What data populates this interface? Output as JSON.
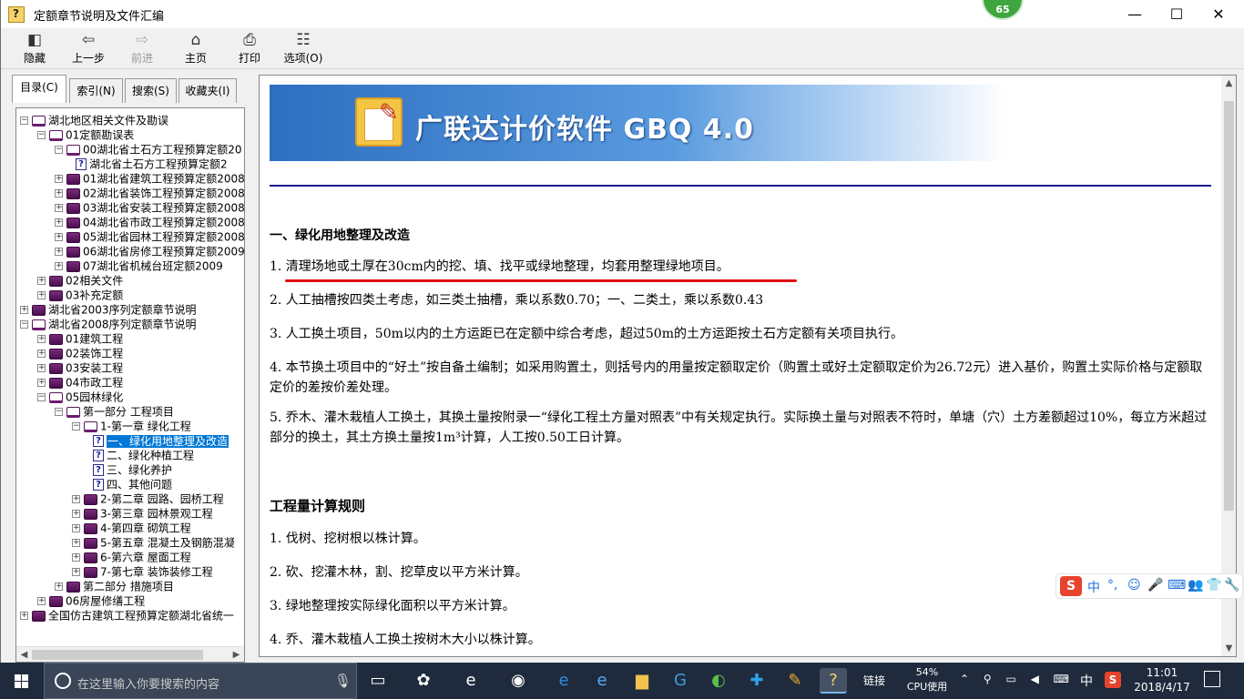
{
  "window": {
    "title": "定额章节说明及文件汇编",
    "badge": "65"
  },
  "toolbar": {
    "hide": "隐藏",
    "back": "上一步",
    "forward": "前进",
    "home": "主页",
    "print": "打印",
    "options": "选项(O)"
  },
  "tabs": [
    "目录(C)",
    "索引(N)",
    "搜索(S)",
    "收藏夹(I)"
  ],
  "tree": [
    {
      "label": "湖北地区相关文件及勘误",
      "level": 0,
      "exp": "-",
      "icon": "book-open"
    },
    {
      "label": "01定额勘误表",
      "level": 1,
      "exp": "-",
      "icon": "book-open"
    },
    {
      "label": "00湖北省土石方工程预算定额20",
      "level": 2,
      "exp": "-",
      "icon": "book-open"
    },
    {
      "label": "湖北省土石方工程预算定额2",
      "level": 3,
      "exp": "",
      "icon": "help-page"
    },
    {
      "label": "01湖北省建筑工程预算定额2008",
      "level": 2,
      "exp": "+",
      "icon": "book-closed"
    },
    {
      "label": "02湖北省装饰工程预算定额2008",
      "level": 2,
      "exp": "+",
      "icon": "book-closed"
    },
    {
      "label": "03湖北省安装工程预算定额2008",
      "level": 2,
      "exp": "+",
      "icon": "book-closed"
    },
    {
      "label": "04湖北省市政工程预算定额2008",
      "level": 2,
      "exp": "+",
      "icon": "book-closed"
    },
    {
      "label": "05湖北省园林工程预算定额2008",
      "level": 2,
      "exp": "+",
      "icon": "book-closed"
    },
    {
      "label": "06湖北省房修工程预算定额2009",
      "level": 2,
      "exp": "+",
      "icon": "book-closed"
    },
    {
      "label": "07湖北省机械台班定额2009",
      "level": 2,
      "exp": "+",
      "icon": "book-closed"
    },
    {
      "label": "02相关文件",
      "level": 1,
      "exp": "+",
      "icon": "book-closed"
    },
    {
      "label": "03补充定额",
      "level": 1,
      "exp": "+",
      "icon": "book-closed"
    },
    {
      "label": "湖北省2003序列定额章节说明",
      "level": 0,
      "exp": "+",
      "icon": "book-closed"
    },
    {
      "label": "湖北省2008序列定额章节说明",
      "level": 0,
      "exp": "-",
      "icon": "book-open"
    },
    {
      "label": "01建筑工程",
      "level": 1,
      "exp": "+",
      "icon": "book-closed"
    },
    {
      "label": "02装饰工程",
      "level": 1,
      "exp": "+",
      "icon": "book-closed"
    },
    {
      "label": "03安装工程",
      "level": 1,
      "exp": "+",
      "icon": "book-closed"
    },
    {
      "label": "04市政工程",
      "level": 1,
      "exp": "+",
      "icon": "book-closed"
    },
    {
      "label": "05园林绿化",
      "level": 1,
      "exp": "-",
      "icon": "book-open"
    },
    {
      "label": "第一部分 工程项目",
      "level": 2,
      "exp": "-",
      "icon": "book-open"
    },
    {
      "label": "1-第一章 绿化工程",
      "level": 3,
      "exp": "-",
      "icon": "book-open"
    },
    {
      "label": "一、绿化用地整理及改造",
      "level": 4,
      "exp": "",
      "icon": "help-page",
      "selected": true
    },
    {
      "label": "二、绿化种植工程",
      "level": 4,
      "exp": "",
      "icon": "help-page"
    },
    {
      "label": "三、绿化养护",
      "level": 4,
      "exp": "",
      "icon": "help-page"
    },
    {
      "label": "四、其他问题",
      "level": 4,
      "exp": "",
      "icon": "help-page"
    },
    {
      "label": "2-第二章 园路、园桥工程",
      "level": 3,
      "exp": "+",
      "icon": "book-closed"
    },
    {
      "label": "3-第三章 园林景观工程",
      "level": 3,
      "exp": "+",
      "icon": "book-closed"
    },
    {
      "label": "4-第四章 砌筑工程",
      "level": 3,
      "exp": "+",
      "icon": "book-closed"
    },
    {
      "label": "5-第五章 混凝土及钢筋混凝",
      "level": 3,
      "exp": "+",
      "icon": "book-closed"
    },
    {
      "label": "6-第六章 屋面工程",
      "level": 3,
      "exp": "+",
      "icon": "book-closed"
    },
    {
      "label": "7-第七章 装饰装修工程",
      "level": 3,
      "exp": "+",
      "icon": "book-closed"
    },
    {
      "label": "第二部分 措施项目",
      "level": 2,
      "exp": "+",
      "icon": "book-closed"
    },
    {
      "label": "06房屋修缮工程",
      "level": 1,
      "exp": "+",
      "icon": "book-closed"
    },
    {
      "label": "全国仿古建筑工程预算定额湖北省统一",
      "level": 0,
      "exp": "+",
      "icon": "book-closed"
    }
  ],
  "content": {
    "banner_title": "广联达计价软件 GBQ 4.0",
    "section1_heading": "一、绿化用地整理及改造",
    "section1_items": [
      "1. 清理场地或土厚在30cm内的挖、填、找平或绿地整理，均套用整理绿地项目。",
      "2. 人工抽槽按四类土考虑，如三类土抽槽，乘以系数0.70；一、二类土，乘以系数0.43",
      "3. 人工换土项目，50m以内的土方运距已在定额中综合考虑，超过50m的土方运距按土石方定额有关项目执行。",
      "4. 本节换土项目中的“好土”按自备土编制；如采用购置土，则括号内的用量按定额取定价（购置土或好土定额取定价为26.72元）进入基价，购置土实际价格与定额取定价的差按价差处理。",
      "5. 乔木、灌木栽植人工换土，其换土量按附录一“绿化工程土方量对照表”中有关规定执行。实际换土量与对照表不符时，单塘（穴）土方差额超过10%，每立方米超过部分的换土，其土方换土量按1m³计算，人工按0.50工日计算。"
    ],
    "section2_heading": "工程量计算规则",
    "section2_items": [
      "1. 伐树、挖树根以株计算。",
      "2. 砍、挖灌木林，割、挖草皮以平方米计算。",
      "3. 绿地整理按实际绿化面积以平方米计算。",
      "4. 乔、灌木栽植人工换土按树木大小以株计算。"
    ]
  },
  "ime": {
    "lang": "中"
  },
  "taskbar": {
    "search_placeholder": "在这里输入你要搜索的内容",
    "tray_label": "链接",
    "cpu_percent": "54%",
    "cpu_label": "CPU使用",
    "ime_lang": "中",
    "time": "11:01",
    "date": "2018/4/17"
  }
}
